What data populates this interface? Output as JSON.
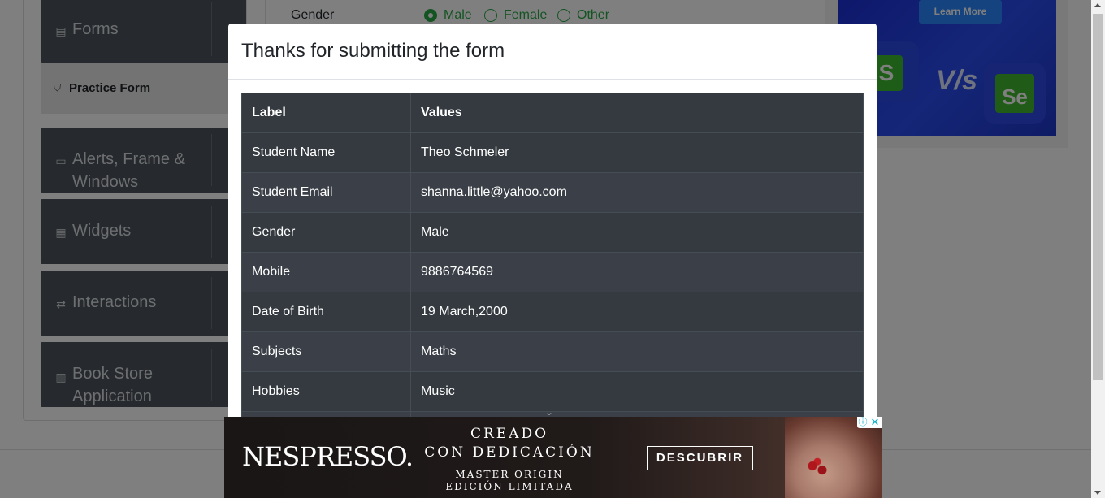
{
  "sidebar": {
    "groups": [
      {
        "label": "Forms",
        "icon": "document-icon"
      },
      {
        "label": "Alerts, Frame & Windows",
        "icon": "window-icon"
      },
      {
        "label": "Widgets",
        "icon": "widgets-icon"
      },
      {
        "label": "Interactions",
        "icon": "interactions-icon"
      },
      {
        "label": "Book Store Application",
        "icon": "books-icon"
      }
    ],
    "active_item": {
      "label": "Practice Form",
      "icon": "html5-icon"
    }
  },
  "form": {
    "gender_label": "Gender",
    "options": [
      "Male",
      "Female",
      "Other"
    ],
    "selected": "Male"
  },
  "right_ad": {
    "button_label": "Learn More",
    "vs_text": "V/s",
    "se_text": "Se",
    "s_text": "S"
  },
  "modal": {
    "title": "Thanks for submitting the form",
    "headers": [
      "Label",
      "Values"
    ],
    "rows": [
      {
        "label": "Student Name",
        "value": "Theo Schmeler"
      },
      {
        "label": "Student Email",
        "value": "shanna.little@yahoo.com"
      },
      {
        "label": "Gender",
        "value": "Male"
      },
      {
        "label": "Mobile",
        "value": "9886764569"
      },
      {
        "label": "Date of Birth",
        "value": "19 March,2000"
      },
      {
        "label": "Subjects",
        "value": "Maths"
      },
      {
        "label": "Hobbies",
        "value": "Music"
      }
    ]
  },
  "bottom_ad": {
    "brand": "NESPRESSO.",
    "headline_line1": "CREADO",
    "headline_line2": "CON DEDICACIÓN",
    "sub_line1": "MASTER ORIGIN",
    "sub_line2": "EDICIÓN LIMITADA",
    "cta": "DESCUBRIR",
    "info_glyph": "ⓘ",
    "close_glyph": "✕"
  },
  "colors": {
    "sidebar_bg": "#4c525a",
    "table_dark": "#343a40",
    "table_stripe": "#3b4048",
    "radio_green": "#28a745",
    "overlay": "rgba(0,0,0,0.5)"
  }
}
